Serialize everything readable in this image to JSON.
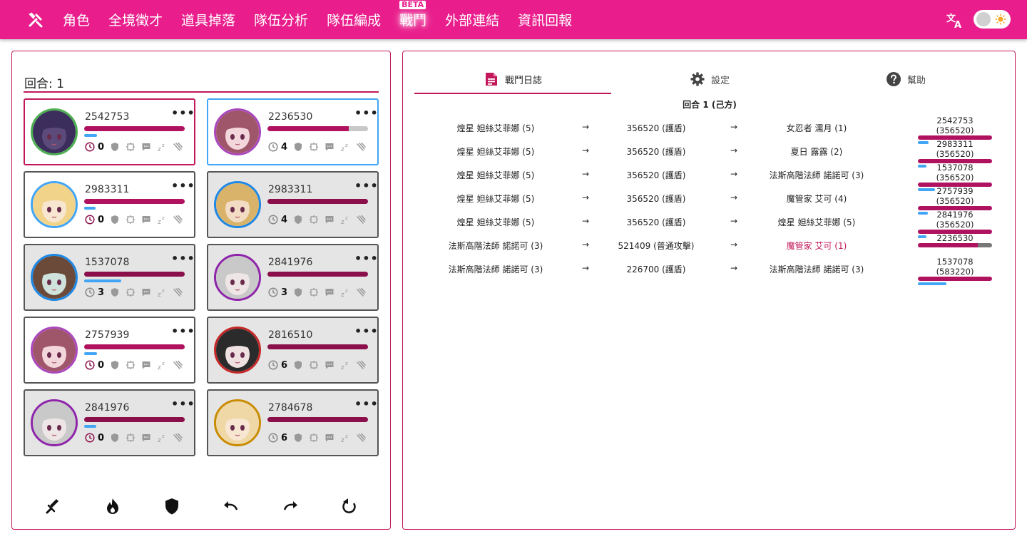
{
  "nav": {
    "items": [
      "角色",
      "全境徵才",
      "道具掉落",
      "隊伍分析",
      "隊伍編成",
      "戰鬥",
      "外部連結",
      "資訊回報"
    ],
    "beta_badge": "BETA"
  },
  "colors": {
    "primary": "#e91e8c",
    "accent": "#c2185b",
    "hp": "#b0125f",
    "shield": "#42a5f5"
  },
  "left": {
    "round_label": "回合: 1",
    "cards": [
      {
        "hp": "2542753",
        "cd": "0",
        "hp_ratio": 1.0,
        "shield_ratio": 0.13,
        "ring": "#4caf50",
        "dim": false,
        "frame": "red",
        "face": "#5b4a7a",
        "hair": "#3b2d5c"
      },
      {
        "hp": "2236530",
        "cd": "4",
        "hp_ratio": 0.81,
        "shield_ratio": 0,
        "ring": "#ab47bc",
        "dim": false,
        "frame": "blue",
        "face": "#f3d6dc",
        "hair": "#a0566a"
      },
      {
        "hp": "2983311",
        "cd": "0",
        "hp_ratio": 1.0,
        "shield_ratio": 0.11,
        "ring": "#42a5f5",
        "dim": false,
        "frame": "gray",
        "face": "#f7e6d0",
        "hair": "#f2d38a"
      },
      {
        "hp": "2983311",
        "cd": "4",
        "hp_ratio": 1.0,
        "shield_ratio": 0,
        "ring": "#1e88e5",
        "dim": true,
        "frame": "gray",
        "face": "#f2dcc4",
        "hair": "#d9b36a"
      },
      {
        "hp": "1537078",
        "cd": "3",
        "hp_ratio": 1.0,
        "shield_ratio": 0.37,
        "ring": "#1e88e5",
        "dim": true,
        "frame": "gray",
        "face": "#cfe3dc",
        "hair": "#6b4a3a"
      },
      {
        "hp": "2841976",
        "cd": "3",
        "hp_ratio": 1.0,
        "shield_ratio": 0,
        "ring": "#8e24aa",
        "dim": true,
        "frame": "gray",
        "face": "#eee6e6",
        "hair": "#c9c9c9"
      },
      {
        "hp": "2757939",
        "cd": "0",
        "hp_ratio": 1.0,
        "shield_ratio": 0.13,
        "ring": "#ab47bc",
        "dim": false,
        "frame": "gray",
        "face": "#f3d6dc",
        "hair": "#a0566a"
      },
      {
        "hp": "2816510",
        "cd": "6",
        "hp_ratio": 1.0,
        "shield_ratio": 0,
        "ring": "#c62828",
        "dim": true,
        "frame": "gray",
        "face": "#efe1e1",
        "hair": "#2b2b2b"
      },
      {
        "hp": "2841976",
        "cd": "0",
        "hp_ratio": 1.0,
        "shield_ratio": 0.12,
        "ring": "#8e24aa",
        "dim": true,
        "frame": "gray",
        "face": "#eee6e6",
        "hair": "#c9c9c9"
      },
      {
        "hp": "2784678",
        "cd": "6",
        "hp_ratio": 1.0,
        "shield_ratio": 0,
        "ring": "#c98b00",
        "dim": true,
        "frame": "gray",
        "face": "#f6e6d2",
        "hair": "#efd8a6"
      }
    ],
    "actions": [
      "sword-icon",
      "fire-icon",
      "shield-icon",
      "undo-icon",
      "redo-icon",
      "reset-icon"
    ]
  },
  "right": {
    "tabs": [
      {
        "label": "戰鬥日誌",
        "icon": "document-icon"
      },
      {
        "label": "設定",
        "icon": "gear-icon"
      },
      {
        "label": "幫助",
        "icon": "help-icon"
      }
    ],
    "log_round": "回合 1 (己方)",
    "arrow": "→",
    "log": [
      {
        "src": "煌星 妲絲艾菲娜 (5)",
        "action": "356520 (護盾)",
        "target": "女忍者 濡月 (1)",
        "highlight": false
      },
      {
        "src": "煌星 妲絲艾菲娜 (5)",
        "action": "356520 (護盾)",
        "target": "夏日 露露 (2)",
        "highlight": false
      },
      {
        "src": "煌星 妲絲艾菲娜 (5)",
        "action": "356520 (護盾)",
        "target": "法斯高階法師 諾諾可 (3)",
        "highlight": false
      },
      {
        "src": "煌星 妲絲艾菲娜 (5)",
        "action": "356520 (護盾)",
        "target": "魔管家 艾可 (4)",
        "highlight": false
      },
      {
        "src": "煌星 妲絲艾菲娜 (5)",
        "action": "356520 (護盾)",
        "target": "煌星 妲絲艾菲娜 (5)",
        "highlight": false
      },
      {
        "src": "法斯高階法師 諾諾可 (3)",
        "action": "521409 (普通攻擊)",
        "target": "魔管家 艾可 (1)",
        "highlight": true
      },
      {
        "src": "法斯高階法師 諾諾可 (3)",
        "action": "226700 (護盾)",
        "target": "法斯高階法師 諾諾可 (3)",
        "highlight": false
      }
    ],
    "hp_summary": [
      {
        "label": "2542753 (356520)",
        "hp_ratio": 1.0,
        "shield_ratio": 0.14
      },
      {
        "label": "2983311 (356520)",
        "hp_ratio": 1.0,
        "shield_ratio": 0.12
      },
      {
        "label": "1537078 (356520)",
        "hp_ratio": 1.0,
        "shield_ratio": 0.23
      },
      {
        "label": "2757939 (356520)",
        "hp_ratio": 1.0,
        "shield_ratio": 0.13
      },
      {
        "label": "2841976 (356520)",
        "hp_ratio": 1.0,
        "shield_ratio": 0.12
      },
      {
        "label": "2236530",
        "hp_ratio": 0.81,
        "shield_ratio": 0
      },
      {
        "label": "1537078 (583220)",
        "hp_ratio": 1.0,
        "shield_ratio": 0.38
      }
    ]
  }
}
